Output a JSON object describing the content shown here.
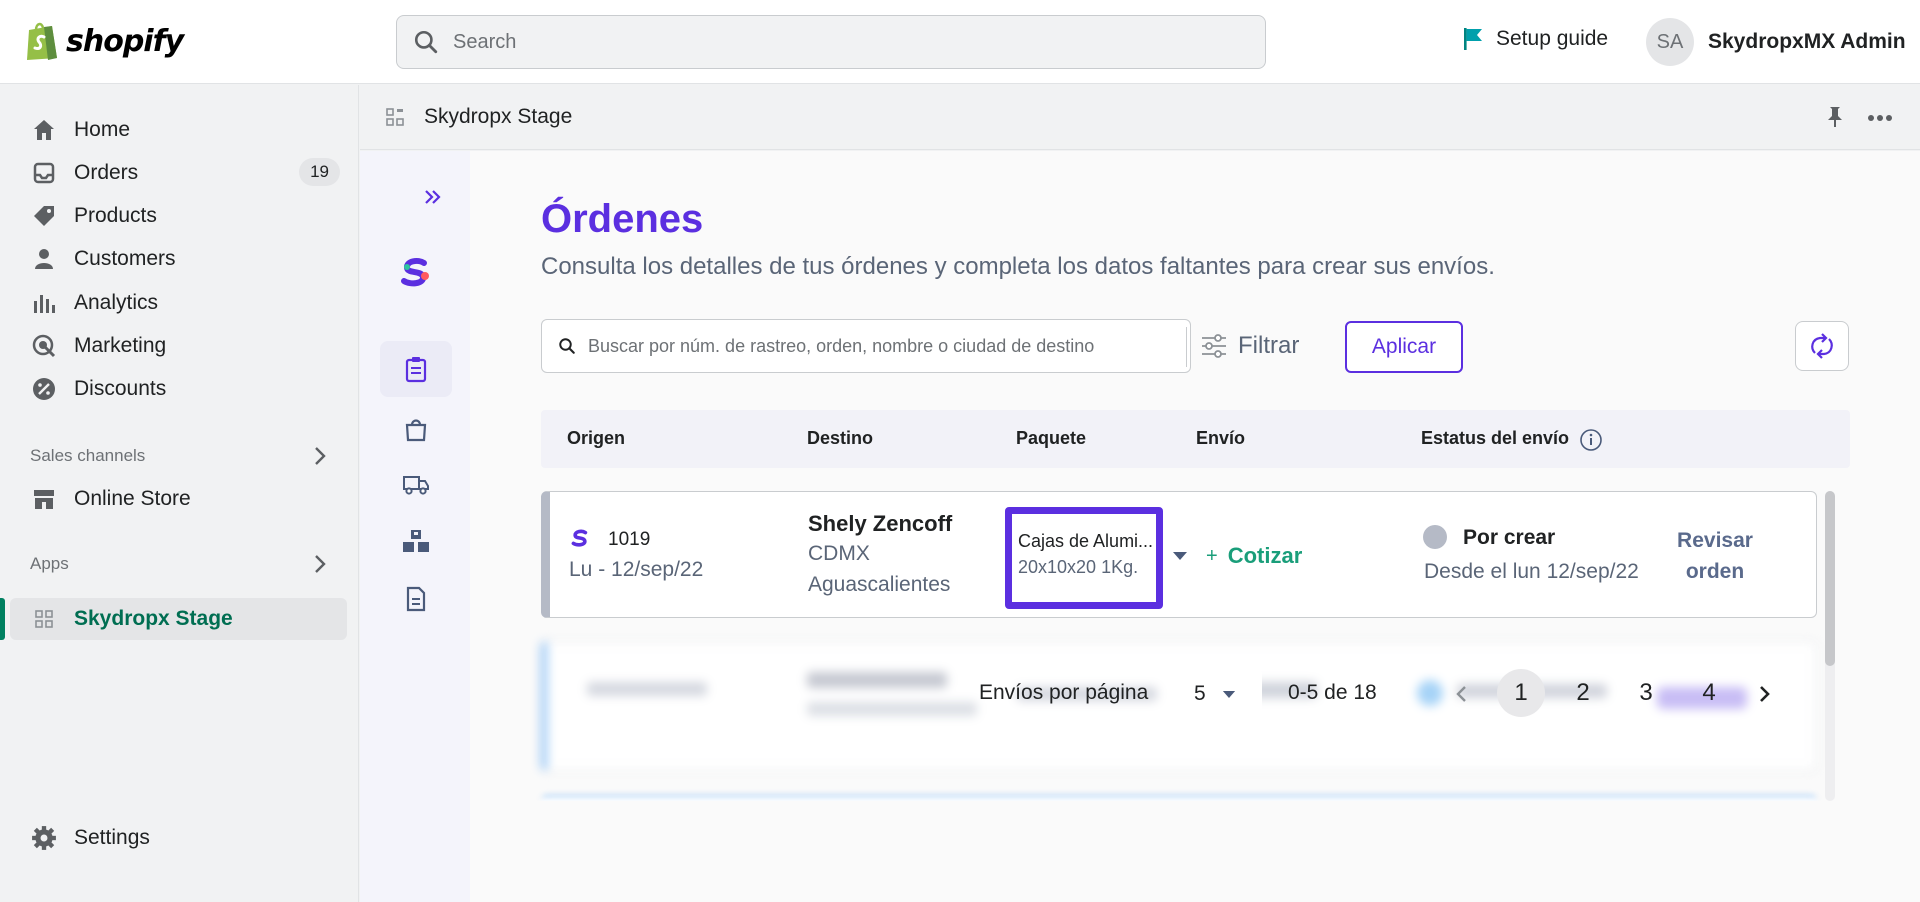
{
  "topbar": {
    "logo_text": "shopify",
    "search_placeholder": "Search",
    "setup_guide": "Setup guide",
    "avatar_initials": "SA",
    "user_name": "SkydropxMX Admin"
  },
  "sidebar": {
    "items": [
      {
        "label": "Home",
        "icon": "home-icon"
      },
      {
        "label": "Orders",
        "icon": "orders-icon",
        "badge": "19"
      },
      {
        "label": "Products",
        "icon": "tag-icon"
      },
      {
        "label": "Customers",
        "icon": "person-icon"
      },
      {
        "label": "Analytics",
        "icon": "bar-chart-icon"
      },
      {
        "label": "Marketing",
        "icon": "target-icon"
      },
      {
        "label": "Discounts",
        "icon": "discount-icon"
      }
    ],
    "sales_channels_label": "Sales channels",
    "online_store": "Online Store",
    "apps_label": "Apps",
    "active_app": "Skydropx Stage",
    "settings": "Settings"
  },
  "app_header": {
    "title": "Skydropx Stage"
  },
  "main": {
    "title": "Órdenes",
    "subtitle": "Consulta los detalles de tus órdenes y completa los datos faltantes para crear sus envíos.",
    "search_placeholder": "Buscar por núm. de rastreo, orden, nombre o ciudad de destino",
    "filter_label": "Filtrar",
    "apply_label": "Aplicar",
    "columns": [
      "Origen",
      "Destino",
      "Paquete",
      "Envío",
      "Estatus del envío"
    ],
    "order": {
      "number": "1019",
      "date": "Lu - 12/sep/22",
      "dest_name": "Shely Zencoff",
      "dest_city": "CDMX",
      "dest_state": "Aguascalientes",
      "package_name": "Cajas de Alumi...",
      "package_dims": "20x10x20 1Kg.",
      "quote_label": "Cotizar",
      "status": "Por crear",
      "status_since": "Desde el lun 12/sep/22",
      "review_line1": "Revisar",
      "review_line2": "orden"
    },
    "pagination": {
      "per_page_label": "Envíos por página",
      "per_page_value": "5",
      "range": "0-5 de 18",
      "pages": [
        "1",
        "2",
        "3",
        "4"
      ],
      "current": "1"
    }
  },
  "colors": {
    "brand_purple": "#5b2fe0",
    "shopify_green": "#008060",
    "quote_green": "#1a9e7a"
  }
}
